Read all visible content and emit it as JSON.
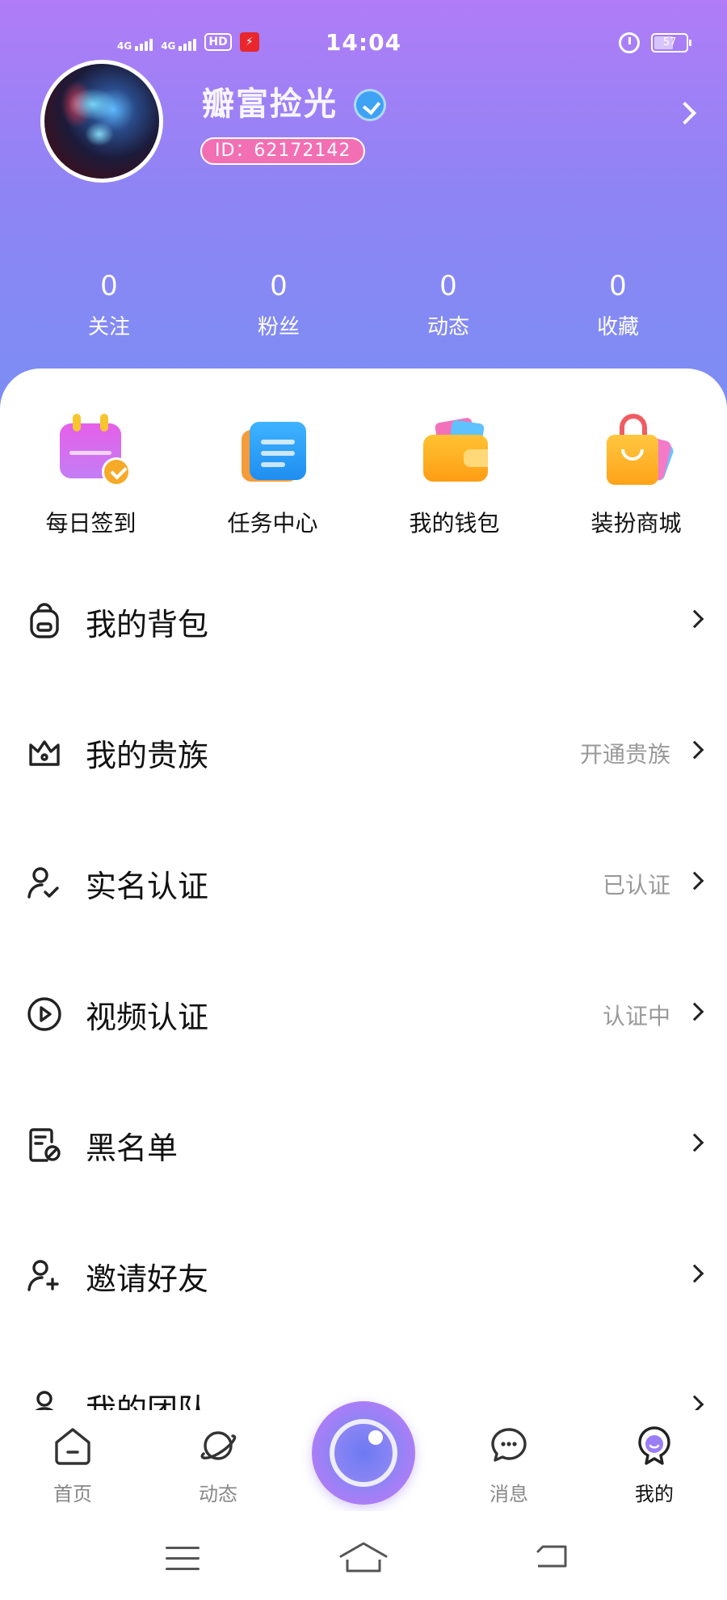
{
  "status_bar": {
    "network1": "4G",
    "network2": "4G",
    "hd": "HD",
    "time": "14:04",
    "battery": "57"
  },
  "profile": {
    "username": "瓣富捡光",
    "id_label": "ID：62172142"
  },
  "stats": [
    {
      "value": "0",
      "label": "关注"
    },
    {
      "value": "0",
      "label": "粉丝"
    },
    {
      "value": "0",
      "label": "动态"
    },
    {
      "value": "0",
      "label": "收藏"
    }
  ],
  "quick_actions": [
    {
      "label": "每日签到",
      "icon": "calendar-check-icon"
    },
    {
      "label": "任务中心",
      "icon": "task-doc-icon"
    },
    {
      "label": "我的钱包",
      "icon": "wallet-icon"
    },
    {
      "label": "装扮商城",
      "icon": "shopping-bag-icon"
    }
  ],
  "menu": [
    {
      "label": "我的背包",
      "value": "",
      "icon": "backpack-icon"
    },
    {
      "label": "我的贵族",
      "value": "开通贵族",
      "icon": "crown-icon"
    },
    {
      "label": "实名认证",
      "value": "已认证",
      "icon": "user-check-icon"
    },
    {
      "label": "视频认证",
      "value": "认证中",
      "icon": "play-circle-icon"
    },
    {
      "label": "黑名单",
      "value": "",
      "icon": "blacklist-icon"
    },
    {
      "label": "邀请好友",
      "value": "",
      "icon": "user-plus-icon"
    },
    {
      "label": "我的团队",
      "value": "",
      "icon": "team-icon"
    }
  ],
  "tabs": [
    {
      "label": "首页",
      "icon": "home-icon"
    },
    {
      "label": "动态",
      "icon": "planet-icon"
    },
    {
      "label": "",
      "icon": "camera-center-icon"
    },
    {
      "label": "消息",
      "icon": "message-icon"
    },
    {
      "label": "我的",
      "icon": "profile-tab-icon",
      "active": true
    }
  ],
  "colors": {
    "header_top": "#b07cf7",
    "header_bottom": "#7a8ef3",
    "id_badge": "#f36fb4",
    "muted_text": "#999999"
  }
}
